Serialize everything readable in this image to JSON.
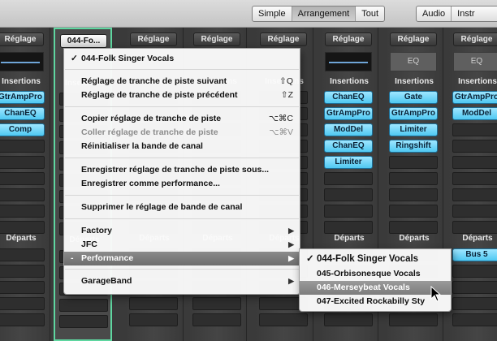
{
  "toolbar": {
    "view_buttons": [
      {
        "label": "Simple",
        "selected": false
      },
      {
        "label": "Arrangement",
        "selected": true
      },
      {
        "label": "Tout",
        "selected": false
      }
    ],
    "filter_buttons": [
      {
        "label": "Audio"
      },
      {
        "label": "Instr"
      }
    ]
  },
  "strips": [
    {
      "setting": "Réglage",
      "eq": "display",
      "inserts": [
        "GtrAmpPro",
        "ChanEQ",
        "Comp"
      ],
      "bus": ""
    },
    {
      "setting": "044-Fo...",
      "eq": "none",
      "inserts": [],
      "bus": ""
    },
    {
      "setting": "Réglage",
      "eq": "none",
      "inserts": [],
      "bus": ""
    },
    {
      "setting": "Réglage",
      "eq": "none",
      "inserts": [],
      "bus": ""
    },
    {
      "setting": "Réglage",
      "eq": "none",
      "inserts": [],
      "bus": ""
    },
    {
      "setting": "Réglage",
      "eq": "display",
      "inserts": [
        "ChanEQ",
        "GtrAmpPro",
        "ModDel",
        "ChanEQ",
        "Limiter"
      ],
      "bus": ""
    },
    {
      "setting": "Réglage",
      "eq": "EQ",
      "inserts": [
        "Gate",
        "GtrAmpPro",
        "Limiter",
        "Ringshift"
      ],
      "bus": ""
    },
    {
      "setting": "Réglage",
      "eq": "EQ",
      "inserts": [
        "GtrAmpPro",
        "ModDel"
      ],
      "bus": "Bus 5"
    }
  ],
  "labels": {
    "insertions": "Insertions",
    "departs": "Départs"
  },
  "menu": {
    "checked_item": "044-Folk Singer Vocals",
    "next_setting": "Réglage de tranche de piste suivant",
    "next_shortcut": "⇧Q",
    "prev_setting": "Réglage de tranche de piste précédent",
    "prev_shortcut": "⇧Z",
    "copy_setting": "Copier réglage de tranche de piste",
    "copy_shortcut": "⌥⌘C",
    "paste_setting": "Coller réglage de tranche de piste",
    "paste_shortcut": "⌥⌘V",
    "reset_strip": "Réinitialiser la bande de canal",
    "save_setting_as": "Enregistrer réglage de tranche de piste sous...",
    "save_as_performance": "Enregistrer comme performance...",
    "delete_setting": "Supprimer le réglage de bande de canal",
    "factory": "Factory",
    "jfc": "JFC",
    "performance": "Performance",
    "garageband": "GarageBand"
  },
  "submenu": {
    "items": [
      "044-Folk Singer Vocals",
      "045-Orbisonesque Vocals",
      "046-Merseybeat Vocals",
      "047-Excited Rockabilly Sty"
    ],
    "checked_index": 0,
    "hovered_index": 2
  }
}
